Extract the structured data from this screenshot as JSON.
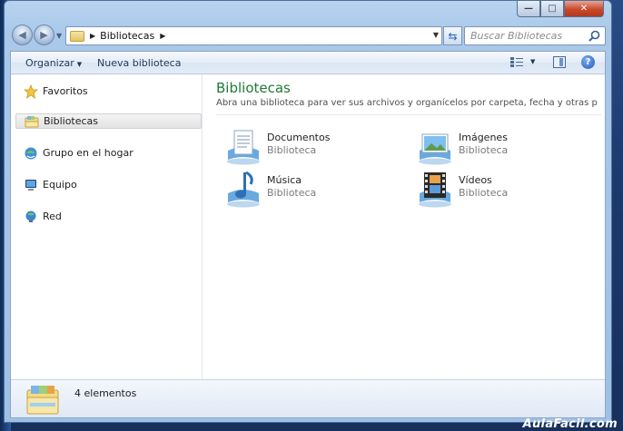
{
  "window": {
    "address_segment": "Bibliotecas",
    "search_placeholder": "Buscar Bibliotecas"
  },
  "toolbar": {
    "organize_label": "Organizar",
    "new_library_label": "Nueva biblioteca"
  },
  "sidebar": {
    "items": [
      {
        "label": "Favoritos",
        "icon": "star-icon"
      },
      {
        "label": "Bibliotecas",
        "icon": "library-icon",
        "selected": true
      },
      {
        "label": "Grupo en el hogar",
        "icon": "homegroup-icon"
      },
      {
        "label": "Equipo",
        "icon": "computer-icon"
      },
      {
        "label": "Red",
        "icon": "network-icon"
      }
    ]
  },
  "main": {
    "title": "Bibliotecas",
    "subtitle": "Abra una biblioteca para ver sus archivos y organícelos por carpeta, fecha y otras propieda...",
    "libraries": [
      {
        "name": "Documentos",
        "kind": "Biblioteca",
        "icon": "documents-icon"
      },
      {
        "name": "Imágenes",
        "kind": "Biblioteca",
        "icon": "pictures-icon"
      },
      {
        "name": "Música",
        "kind": "Biblioteca",
        "icon": "music-icon"
      },
      {
        "name": "Vídeos",
        "kind": "Biblioteca",
        "icon": "videos-icon"
      }
    ]
  },
  "details": {
    "count_text": "4 elementos"
  },
  "watermark": "AulaFacil.com",
  "colors": {
    "title_green": "#1f7a35",
    "window_chrome": "#a9c8ea",
    "close_red": "#c74a2c"
  }
}
